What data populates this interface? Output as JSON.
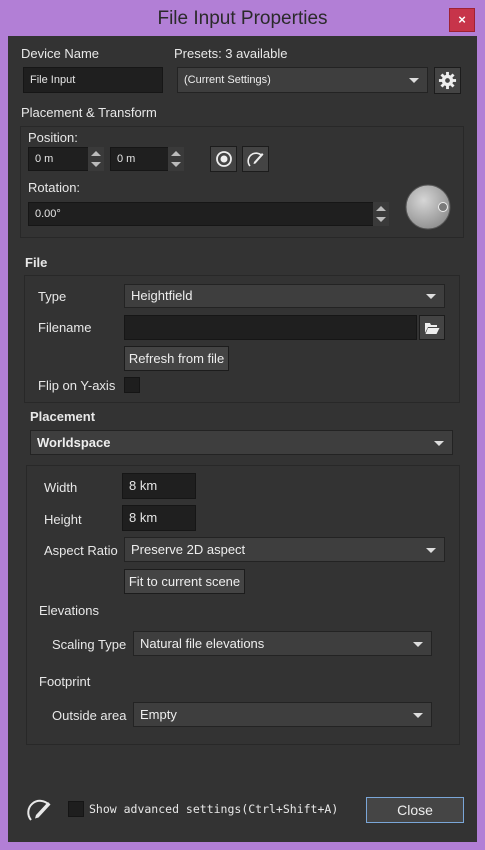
{
  "window": {
    "title": "File Input Properties",
    "close_glyph": "×"
  },
  "device": {
    "label": "Device Name",
    "value": "File Input"
  },
  "presets": {
    "label": "Presets: 3 available",
    "selected": "(Current Settings)"
  },
  "placement_transform": {
    "label": "Placement & Transform",
    "position_label": "Position:",
    "position_x": "0 m",
    "position_y": "0 m",
    "rotation_label": "Rotation:",
    "rotation_value": "0.00°"
  },
  "file": {
    "header": "File",
    "type_label": "Type",
    "type_value": "Heightfield",
    "filename_label": "Filename",
    "filename_value": "",
    "refresh_label": "Refresh from file",
    "flip_label": "Flip on Y-axis",
    "flip_checked": false
  },
  "placement": {
    "header": "Placement",
    "mode": "Worldspace",
    "width_label": "Width",
    "width_value": "8 km",
    "height_label": "Height",
    "height_value": "8 km",
    "aspect_label": "Aspect Ratio",
    "aspect_value": "Preserve 2D aspect",
    "fit_label": "Fit to current scene",
    "elevations_label": "Elevations",
    "scaling_label": "Scaling Type",
    "scaling_value": "Natural file elevations",
    "footprint_label": "Footprint",
    "outside_label": "Outside area",
    "outside_value": "Empty"
  },
  "footer": {
    "advanced_label": "Show advanced settings(Ctrl+Shift+A)",
    "close_label": "Close"
  },
  "colors": {
    "title_bar": "#b27fd6",
    "panel": "#333333",
    "close_x": "#c7344a",
    "close_button_border": "#7aa6d8"
  },
  "icons": [
    "gear-icon",
    "target-icon",
    "edit-icon",
    "folder-open-icon",
    "rotation-dial",
    "notes-icon"
  ]
}
